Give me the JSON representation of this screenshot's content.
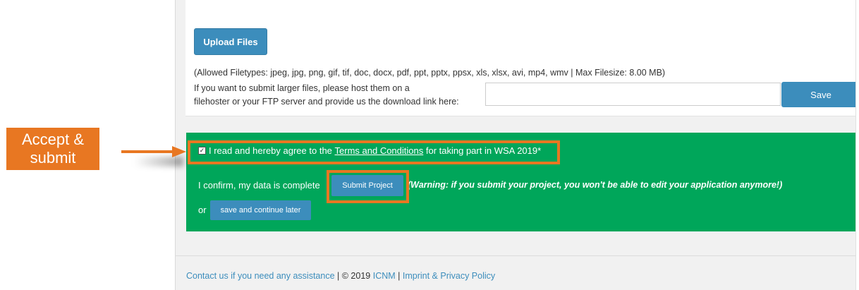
{
  "upload": {
    "button_label": "Upload Files",
    "allowed_text": "(Allowed Filetypes: jpeg, jpg, png, gif, tif, doc, docx, pdf, ppt, pptx, ppsx, xls, xlsx, avi, mp4, wmv | Max Filesize: 8.00 MB)",
    "larger_line1": "If you want to submit larger files, please host them on a",
    "larger_line2": "filehoster or your FTP server and provide us the download link here:",
    "link_value": "",
    "save_label": "Save"
  },
  "submit_panel": {
    "agree_prefix": "I read and hereby agree to the ",
    "terms_link": "Terms and Conditions",
    "agree_suffix": " for taking part in WSA 2019*",
    "checkbox_checked": true,
    "confirm_text": "I confirm, my data is complete",
    "submit_label": "Submit Project",
    "warning_text": "(Warning: if you submit your project, you won't be able to edit your application anymore!)",
    "or_text": "or",
    "later_label": "save and continue later"
  },
  "annotation": {
    "label_line1": "Accept &",
    "label_line2": "submit",
    "color": "#e87722"
  },
  "footer": {
    "contact_link": "Contact us if you need any assistance",
    "copyright": " | © 2019 ",
    "icnm_link": "ICNM",
    "sep": " | ",
    "imprint_link": "Imprint & Privacy Policy"
  },
  "colors": {
    "primary": "#3c8dbc",
    "success_panel": "#00a65a",
    "highlight": "#e87722"
  }
}
